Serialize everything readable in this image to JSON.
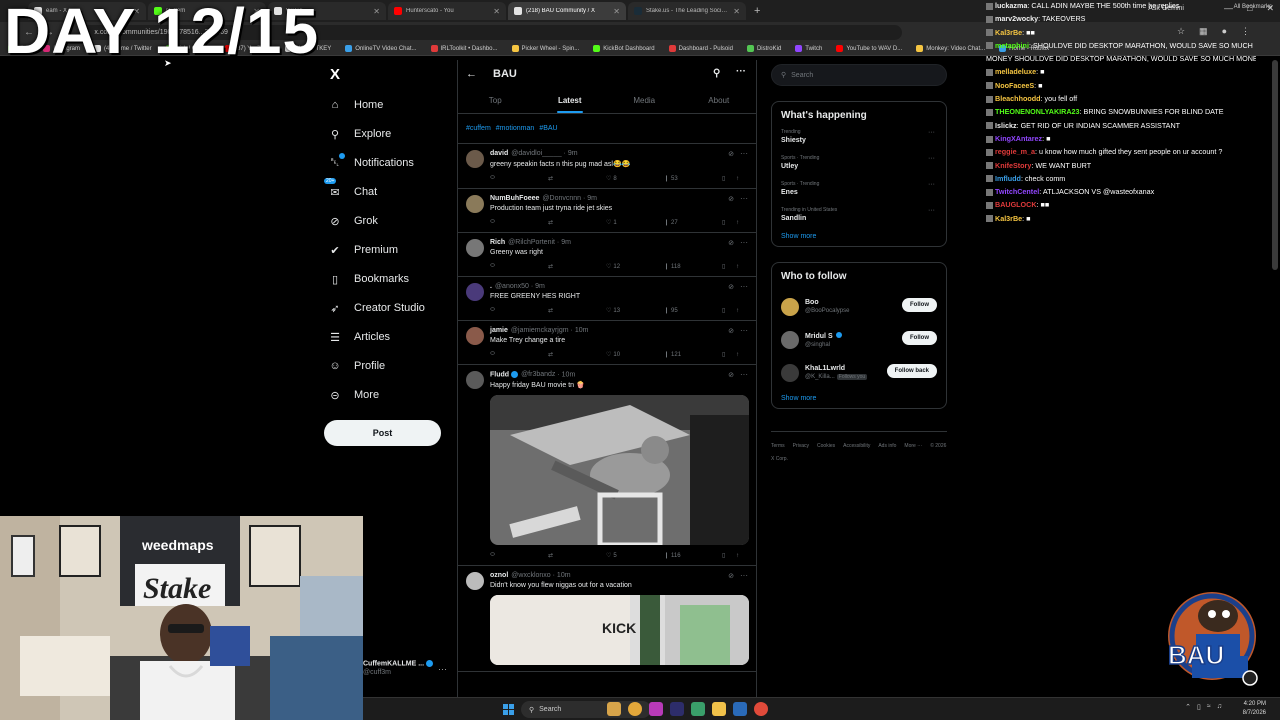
{
  "overlay": {
    "title": "DAY 12/15"
  },
  "browser": {
    "tabs": [
      {
        "label": "eam - X",
        "color": "#e3e3e3",
        "active": false
      },
      {
        "label": "Cuffem",
        "color": "#53fc18",
        "active": false
      },
      {
        "label": "Watch",
        "color": "#e3e3e3",
        "active": false
      },
      {
        "label": "Hunterscato - You",
        "color": "#ff0000",
        "active": false
      },
      {
        "label": "(218) BAU Community / X",
        "color": "#e3e3e3",
        "active": true
      },
      {
        "label": "Stake.us - The Leading Social C",
        "color": "#1a2c38",
        "active": false
      }
    ],
    "new_tab": "+",
    "ask_gemini": "Ask Gemini",
    "url": "x.com/i/communities/1908678516...302169",
    "bookmarks": [
      {
        "label": "Kick",
        "color": "#53fc18"
      },
      {
        "label": "Instagram",
        "color": "#d62976"
      },
      {
        "label": "(4) Home / Twitter",
        "color": "#e3e3e3"
      },
      {
        "label": "Kick | Cuffem",
        "color": "#53fc18"
      },
      {
        "label": "(37) YouTube",
        "color": "#ff0000"
      },
      {
        "label": "BIG BOTKEY",
        "color": "#e3e3e3"
      },
      {
        "label": "OnlineTV Video Chat...",
        "color": "#3a9fe8"
      },
      {
        "label": "IRLToolkit • Dashbo...",
        "color": "#e03a3a"
      },
      {
        "label": "Picker Wheel - Spin...",
        "color": "#f5c542"
      },
      {
        "label": "KickBot Dashboard",
        "color": "#53fc18"
      },
      {
        "label": "Dashboard - Pulsoid",
        "color": "#e03a3a"
      },
      {
        "label": "DistroKid",
        "color": "#53c653"
      },
      {
        "label": "Twitch",
        "color": "#9146ff"
      },
      {
        "label": "YouTube to WAV D...",
        "color": "#ff0000"
      },
      {
        "label": "Monkey: Video Chat...",
        "color": "#f5c542"
      },
      {
        "label": "Home - Roblox",
        "color": "#3a9fe8"
      }
    ],
    "all_bookmarks": "All Bookmarks"
  },
  "nav": {
    "logo": "X",
    "items": [
      {
        "label": "Home",
        "icon": "home-icon"
      },
      {
        "label": "Explore",
        "icon": "search-icon"
      },
      {
        "label": "Notifications",
        "icon": "bell-icon"
      },
      {
        "label": "Chat",
        "icon": "chat-icon"
      },
      {
        "label": "Grok",
        "icon": "grok-icon"
      },
      {
        "label": "Premium",
        "icon": "premium-icon"
      },
      {
        "label": "Bookmarks",
        "icon": "bookmark-icon"
      },
      {
        "label": "Creator Studio",
        "icon": "rocket-icon"
      },
      {
        "label": "Articles",
        "icon": "article-icon"
      },
      {
        "label": "Profile",
        "icon": "person-icon"
      },
      {
        "label": "More",
        "icon": "more-circle-icon"
      }
    ],
    "chat_badge": "20+",
    "post": "Post"
  },
  "account": {
    "name": "CuffemKALLME ...",
    "handle": "@cuff3m"
  },
  "main": {
    "title": "BAU",
    "tabs": [
      "Top",
      "Latest",
      "Media",
      "About"
    ],
    "active_tab": "Latest",
    "hashtags": [
      "#cuffem",
      "#motionman",
      "#BAU"
    ],
    "tweets": [
      {
        "name": "david",
        "handle": "@davidloi_____",
        "time": "9m",
        "text": "greeny speakin facts n this pug mad asl😂😂",
        "likes": "8",
        "views": "53",
        "avatar": "#6b5a4a"
      },
      {
        "name": "NumBuhFoeee",
        "handle": "@Donvcnnn",
        "time": "9m",
        "text": "Production team just tryna ride jet skies",
        "likes": "1",
        "views": "27",
        "avatar": "#8a7a5a"
      },
      {
        "name": "Rich",
        "handle": "@RilchPortenit",
        "time": "9m",
        "text": "Greeny was right",
        "likes": "12",
        "views": "118",
        "avatar": "#777"
      },
      {
        "name": ".",
        "handle": "@anonx50",
        "time": "9m",
        "text": "FREE GREENY HES RIGHT",
        "likes": "13",
        "views": "95",
        "avatar": "#4a3a7a"
      },
      {
        "name": "jamie",
        "handle": "@jamiemckayrjgm",
        "time": "10m",
        "text": "Make Trey change a tire",
        "likes": "10",
        "views": "121",
        "avatar": "#8a5a4a"
      },
      {
        "name": "Fludd",
        "handle": "@fr3bandz",
        "time": "10m",
        "text": "Happy friday BAU movie tn 🍿",
        "likes": "5",
        "views": "116",
        "avatar": "#5a5a5a",
        "verified": true
      },
      {
        "name": "oznol",
        "handle": "@wxcklonxo",
        "time": "10m",
        "text": "Didn't know you flew niggas out for a vacation",
        "likes": "",
        "views": "",
        "avatar": "#bbb"
      }
    ],
    "media_kick_text": "KICK"
  },
  "right": {
    "search_placeholder": "Search",
    "happening_title": "What's happening",
    "trends": [
      {
        "meta": "Trending",
        "title": "Shiesty"
      },
      {
        "meta": "Sports · Trending",
        "title": "Utley"
      },
      {
        "meta": "Sports · Trending",
        "title": "Enes"
      },
      {
        "meta": "Trending in United States",
        "title": "Sandlin"
      }
    ],
    "show_more": "Show more",
    "wtf_title": "Who to follow",
    "wtf": [
      {
        "name": "Boo",
        "handle": "@BooPocalypse",
        "button": "Follow",
        "avatar": "#c9a34a"
      },
      {
        "name": "Mridul S",
        "handle": "@singhal",
        "button": "Follow",
        "avatar": "#6a6a6a",
        "verified": true
      },
      {
        "name": "KhaL1Lwrld",
        "handle": "@K_Killa...",
        "button": "Follow back",
        "avatar": "#3a3a3a",
        "follows_you": "Follows you"
      }
    ],
    "wtf_show_more": "Show more",
    "footer": [
      "Terms",
      "Privacy",
      "Cookies",
      "Accessibility",
      "Ads info",
      "More ···",
      "© 2026 X Corp."
    ]
  },
  "chat": [
    {
      "user": "luckazma",
      "color": "#f0f0f0",
      "msg": "CALL ADIN MAYBE THE 500th time he replies"
    },
    {
      "user": "marv2wocky",
      "color": "#f0f0f0",
      "msg": "TAKEOVERS"
    },
    {
      "user": "Kal3rBe",
      "color": "#f5c542",
      "msg": "■■"
    },
    {
      "user": "metaphini",
      "color": "#53fc18",
      "msg": "SHOULDVE DID DESKTOP MARATHON, WOULD SAVE SO MUCH"
    },
    {
      "user": "",
      "color": "#fff",
      "msg": "MONEY SHOULDVE DID DESKTOP MARATHON, WOULD SAVE SO MUCH MONEY"
    },
    {
      "user": "melladeluxe",
      "color": "#f5c542",
      "msg": "■"
    },
    {
      "user": "NooFaceeS",
      "color": "#f5c542",
      "msg": "■"
    },
    {
      "user": "Bleachhoodd",
      "color": "#f5c542",
      "msg": "you fell off"
    },
    {
      "user": "THEONENONLYAKIRA23",
      "color": "#53fc18",
      "msg": "BRING SNOWBUNNIES FOR BLIND DATE"
    },
    {
      "user": "Islickz",
      "color": "#f0f0f0",
      "msg": "GET RID OF UR INDIAN SCAMMER ASSISTANT"
    },
    {
      "user": "KingXAntarez",
      "color": "#9146ff",
      "msg": "■"
    },
    {
      "user": "reggie_m_a",
      "color": "#e03a3a",
      "msg": "u know how much gifted they sent people on ur account ?"
    },
    {
      "user": "KnifeStory",
      "color": "#e03a3a",
      "msg": "WE WANT BURT"
    },
    {
      "user": "Imfludd",
      "color": "#3a9fe8",
      "msg": "check comm"
    },
    {
      "user": "TwitchCentel",
      "color": "#9146ff",
      "msg": "ATLJACKSON VS @wasteofxanax"
    },
    {
      "user": "BAUGLOCK",
      "color": "#e03a3a",
      "msg": "■■"
    },
    {
      "user": "Kal3rBe",
      "color": "#f5c542",
      "msg": "■"
    }
  ],
  "cam": {
    "brand1": "weedmaps",
    "brand2": "Stake"
  },
  "logo": {
    "text": "BAU"
  },
  "taskbar": {
    "search": "Search",
    "time": "4:20 PM",
    "date": "8/7/2026"
  }
}
